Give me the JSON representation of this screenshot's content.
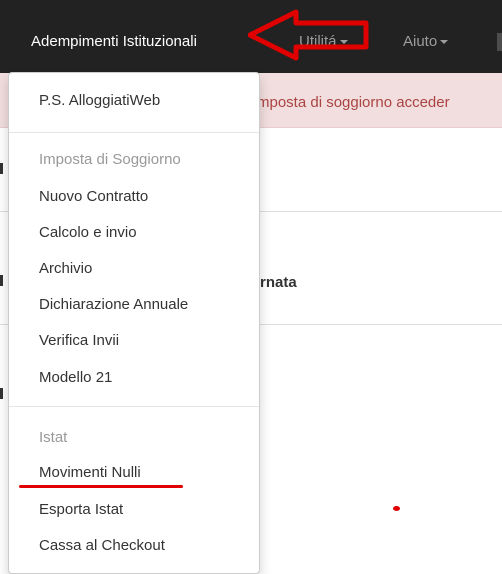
{
  "navbar": {
    "brand": "Adempimenti Istituzionali",
    "utilita_label": "Utilitá",
    "aiuto_label": "Aiuto"
  },
  "background": {
    "alert_text": "mposta di soggiorno acceder",
    "bold_fragment": "rnata"
  },
  "dropdown": {
    "item_ps": "P.S. AlloggiatiWeb",
    "header_imposta": "Imposta di Soggiorno",
    "item_nuovo_contratto": "Nuovo Contratto",
    "item_calcolo": "Calcolo e invio",
    "item_archivio": "Archivio",
    "item_dichiarazione": "Dichiarazione Annuale",
    "item_verifica": "Verifica Invii",
    "item_modello": "Modello 21",
    "header_istat": "Istat",
    "item_movimenti_nulli": "Movimenti Nulli",
    "item_esporta_istat": "Esporta Istat",
    "item_cassa_checkout": "Cassa al Checkout"
  },
  "colors": {
    "navbar_bg": "#222222",
    "annotation_red": "#e00000",
    "alert_bg": "#f2dede",
    "alert_text": "#a94442"
  },
  "icons": {
    "dropdown_caret": "caret-down-icon",
    "annotation": "red-arrow-annotation"
  }
}
